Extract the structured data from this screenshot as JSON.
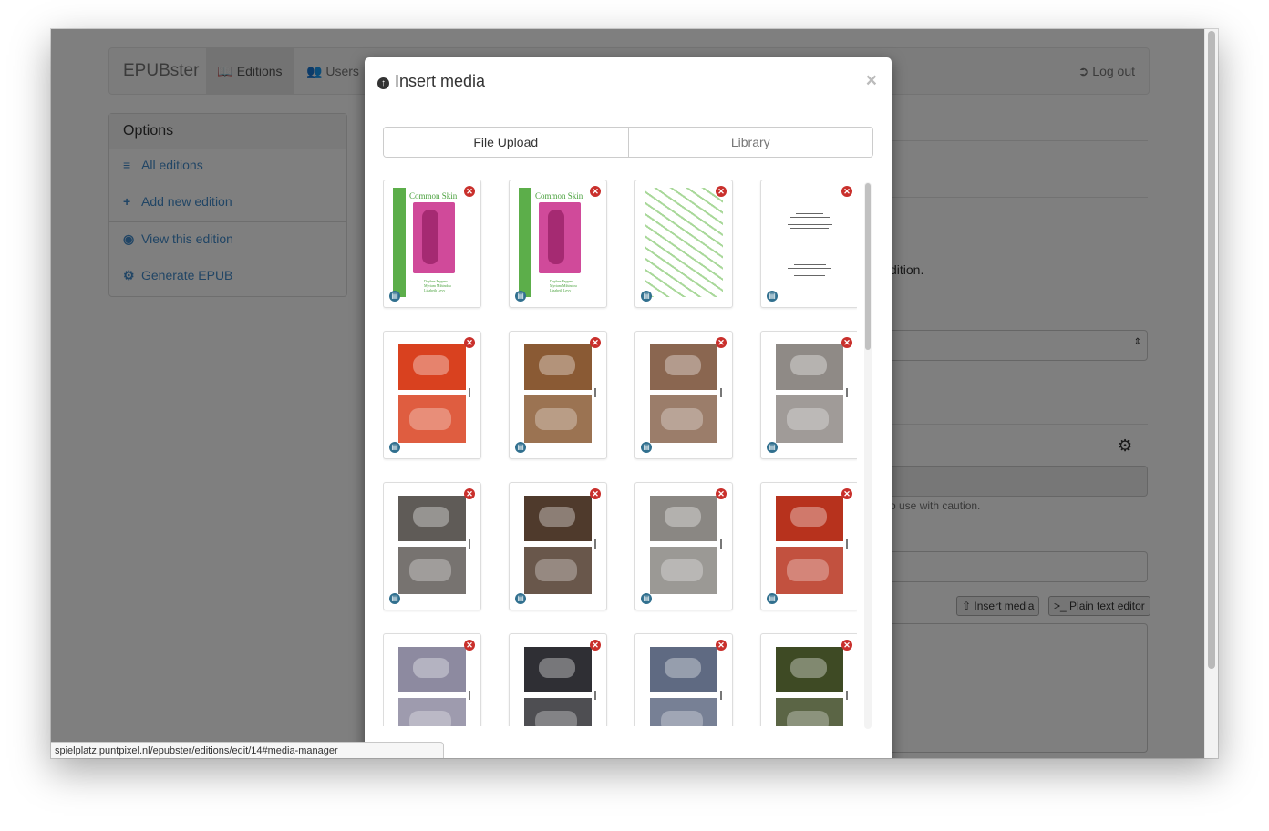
{
  "app": {
    "brand": "EPUBster",
    "nav_editions": "Editions",
    "nav_users": "Users",
    "nav_logout": "Log out"
  },
  "options": {
    "title": "Options",
    "all_editions": "All editions",
    "add_new": "Add new edition",
    "view": "View this edition",
    "generate": "Generate EPUB"
  },
  "background": {
    "edition_fragment": "dition.",
    "caution_fragment": "o use with caution.",
    "insert_media_btn": "Insert media",
    "plain_text_btn": "Plain text editor"
  },
  "modal": {
    "title": "Insert media",
    "close": "×",
    "tabs": [
      "File Upload",
      "Library"
    ]
  },
  "cover": {
    "title": "Common Skin",
    "authors": [
      "Daphne Pappers",
      "Myriam Mihindou",
      "Lizabeth Levy"
    ]
  },
  "media_items": [
    {
      "kind": "cover"
    },
    {
      "kind": "cover"
    },
    {
      "kind": "pattern"
    },
    {
      "kind": "text"
    },
    {
      "kind": "photo",
      "bg": "#d9411f"
    },
    {
      "kind": "photo",
      "bg": "#8a5a34"
    },
    {
      "kind": "photo",
      "bg": "#8a6650"
    },
    {
      "kind": "photo",
      "bg": "#8f8a86"
    },
    {
      "kind": "photo",
      "bg": "#5f5b57"
    },
    {
      "kind": "photo",
      "bg": "#4f3a2c"
    },
    {
      "kind": "photo",
      "bg": "#8a8783"
    },
    {
      "kind": "photo",
      "bg": "#b7321d"
    },
    {
      "kind": "photo",
      "bg": "#8d8aa0"
    },
    {
      "kind": "photo",
      "bg": "#2f2f34"
    },
    {
      "kind": "photo",
      "bg": "#5f6a82"
    },
    {
      "kind": "photo",
      "bg": "#3e4a24"
    }
  ],
  "status_url": "spielplatz.puntpixel.nl/epubster/editions/edit/14#media-manager"
}
